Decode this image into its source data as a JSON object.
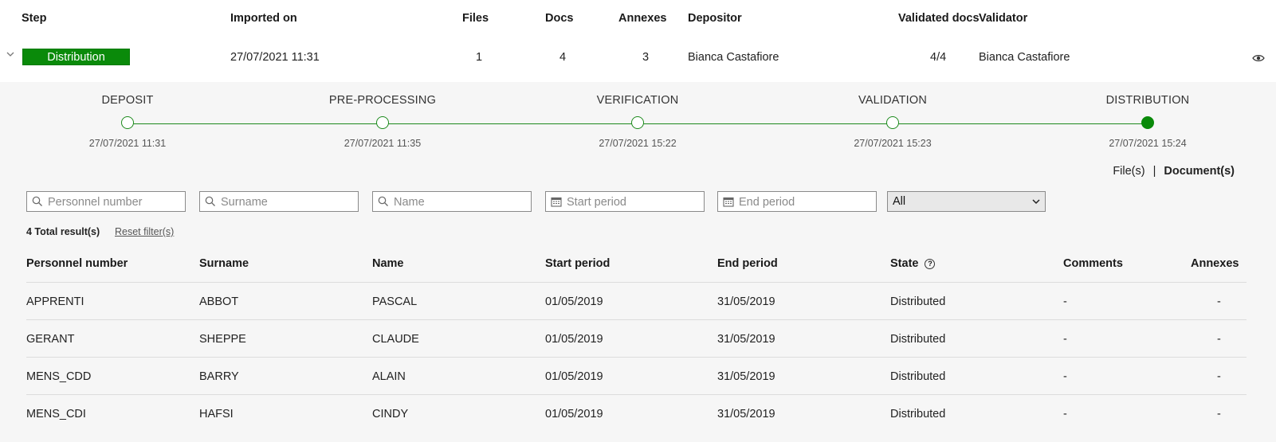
{
  "header": {
    "step": "Step",
    "imported_on": "Imported on",
    "files": "Files",
    "docs": "Docs",
    "annexes": "Annexes",
    "depositor": "Depositor",
    "validated_docs": "Validated docs",
    "validator": "Validator"
  },
  "main_row": {
    "step": "Distribution",
    "imported_on": "27/07/2021 11:31",
    "files": "1",
    "docs": "4",
    "annexes": "3",
    "depositor": "Bianca Castafiore",
    "validated_docs": "4/4",
    "validator": "Bianca Castafiore",
    "icons": {
      "expand": "chevron-down-icon",
      "view": "eye-icon"
    }
  },
  "timeline": [
    {
      "label": "DEPOSIT",
      "date": "27/07/2021 11:31",
      "active": false
    },
    {
      "label": "PRE-PROCESSING",
      "date": "27/07/2021 11:35",
      "active": false
    },
    {
      "label": "VERIFICATION",
      "date": "27/07/2021 15:22",
      "active": false
    },
    {
      "label": "VALIDATION",
      "date": "27/07/2021 15:23",
      "active": false
    },
    {
      "label": "DISTRIBUTION",
      "date": "27/07/2021 15:24",
      "active": true
    }
  ],
  "view_toggle": {
    "files": "File(s)",
    "separator": "|",
    "documents": "Document(s)",
    "selected": "documents"
  },
  "filters": {
    "personnel_number": {
      "placeholder": "Personnel number",
      "value": ""
    },
    "surname": {
      "placeholder": "Surname",
      "value": ""
    },
    "name": {
      "placeholder": "Name",
      "value": ""
    },
    "start_period": {
      "placeholder": "Start period",
      "value": ""
    },
    "end_period": {
      "placeholder": "End period",
      "value": ""
    },
    "state_select": {
      "value": "All"
    }
  },
  "results": {
    "total": "4 Total result(s)",
    "reset": "Reset filter(s)"
  },
  "table": {
    "columns": {
      "personnel_number": "Personnel number",
      "surname": "Surname",
      "name": "Name",
      "start_period": "Start period",
      "end_period": "End period",
      "state": "State",
      "comments": "Comments",
      "annexes": "Annexes"
    },
    "rows": [
      {
        "personnel_number": "APPRENTI",
        "surname": "ABBOT",
        "name": "PASCAL",
        "start": "01/05/2019",
        "end": "31/05/2019",
        "state": "Distributed",
        "comments": "-",
        "annexes": "-"
      },
      {
        "personnel_number": "GERANT",
        "surname": "SHEPPE",
        "name": "CLAUDE",
        "start": "01/05/2019",
        "end": "31/05/2019",
        "state": "Distributed",
        "comments": "-",
        "annexes": "-"
      },
      {
        "personnel_number": "MENS_CDD",
        "surname": "BARRY",
        "name": "ALAIN",
        "start": "01/05/2019",
        "end": "31/05/2019",
        "state": "Distributed",
        "comments": "-",
        "annexes": "-"
      },
      {
        "personnel_number": "MENS_CDI",
        "surname": "HAFSI",
        "name": "CINDY",
        "start": "01/05/2019",
        "end": "31/05/2019",
        "state": "Distributed",
        "comments": "-",
        "annexes": "-"
      }
    ]
  },
  "colors": {
    "accent_green": "#0a8a0a",
    "panel_bg": "#f6f6f6"
  }
}
